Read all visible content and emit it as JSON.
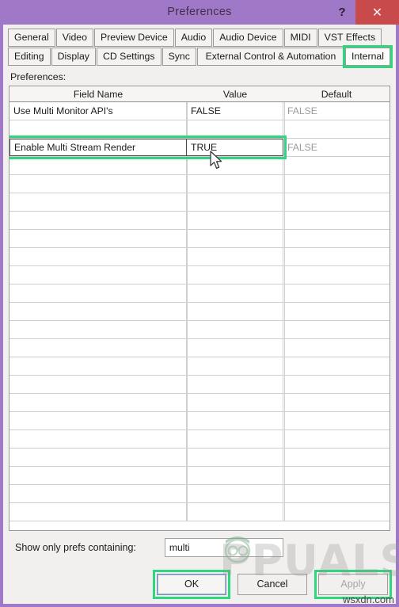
{
  "window": {
    "title": "Preferences",
    "help_label": "?",
    "close_label": "✕",
    "titlebar_color": "#a078c8",
    "close_color": "#c94a4a",
    "highlight_color": "#2fd67f"
  },
  "tabs": {
    "row1": [
      {
        "label": "General",
        "selected": false
      },
      {
        "label": "Video",
        "selected": false
      },
      {
        "label": "Preview Device",
        "selected": false
      },
      {
        "label": "Audio",
        "selected": false
      },
      {
        "label": "Audio Device",
        "selected": false
      },
      {
        "label": "MIDI",
        "selected": false
      },
      {
        "label": "VST Effects",
        "selected": false
      }
    ],
    "row2": [
      {
        "label": "Editing",
        "selected": false
      },
      {
        "label": "Display",
        "selected": false
      },
      {
        "label": "CD Settings",
        "selected": false
      },
      {
        "label": "Sync",
        "selected": false
      },
      {
        "label": "External Control & Automation",
        "selected": false
      },
      {
        "label": "Internal",
        "selected": true
      }
    ]
  },
  "panel": {
    "label": "Preferences:"
  },
  "table": {
    "columns": [
      "Field Name",
      "Value",
      "Default"
    ],
    "rows": [
      {
        "field": "Use Multi Monitor API's",
        "value": "FALSE",
        "default": "FALSE",
        "selected": false
      },
      {
        "field": "",
        "value": "",
        "default": "",
        "selected": false
      },
      {
        "field": "Enable Multi Stream Render",
        "value": "TRUE",
        "default": "FALSE",
        "selected": true
      }
    ],
    "empty_row_count": 20
  },
  "filter": {
    "label": "Show only prefs containing:",
    "value": "multi",
    "placeholder": ""
  },
  "buttons": {
    "ok": "OK",
    "cancel": "Cancel",
    "apply": "Apply"
  },
  "watermarks": {
    "appuals": "PPUALS",
    "wsxdn": "wsxdn.com"
  }
}
